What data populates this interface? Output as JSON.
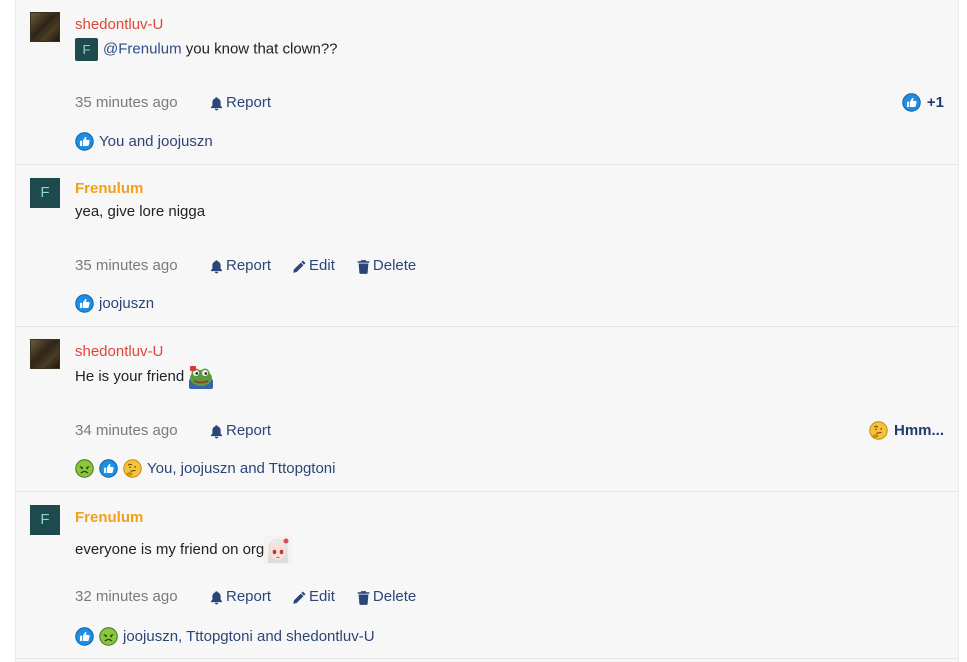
{
  "posts": [
    {
      "username": "shedontluv-U",
      "mention_avatar_letter": "F",
      "mention": "@Frenulum",
      "text": " you know that clown??",
      "time": "35 minutes ago",
      "actions": {
        "report": "Report"
      },
      "right_reaction": {
        "icon": "thumbs-up-icon",
        "label": "+1"
      },
      "reaction_summary": "You and joojuszn"
    },
    {
      "username": "Frenulum",
      "avatar_letter": "F",
      "text": "yea, give lore nigga",
      "time": "35 minutes ago",
      "actions": {
        "report": "Report",
        "edit": "Edit",
        "delete": "Delete"
      },
      "reaction_summary": "joojuszn"
    },
    {
      "username": "shedontluv-U",
      "text": "He is your friend",
      "time": "34 minutes ago",
      "actions": {
        "report": "Report"
      },
      "right_reaction": {
        "icon": "thinking-face-icon",
        "label": "Hmm..."
      },
      "reaction_summary": "You, joojuszn and Tttopgtoni"
    },
    {
      "username": "Frenulum",
      "avatar_letter": "F",
      "text": "everyone is my friend on org",
      "time": "32 minutes ago",
      "actions": {
        "report": "Report",
        "edit": "Edit",
        "delete": "Delete"
      },
      "reaction_summary": "joojuszn, Tttopgtoni and shedontluv-U"
    }
  ],
  "colors": {
    "username_red": "#e0473a",
    "username_orange": "#f0a019",
    "action_blue": "#2c4578",
    "timestamp_gray": "#7a7a7a"
  }
}
